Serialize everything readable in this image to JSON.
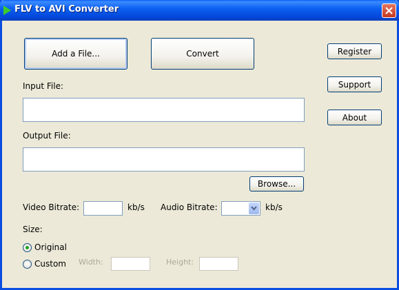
{
  "window": {
    "title": "FLV to AVI Converter"
  },
  "buttons": {
    "add_file": "Add a File...",
    "convert": "Convert",
    "register": "Register",
    "support": "Support",
    "about": "About",
    "browse": "Browse..."
  },
  "input_file": {
    "label": "Input File:",
    "value": ""
  },
  "output_file": {
    "label": "Output File:",
    "value": ""
  },
  "video_bitrate": {
    "label": "Video Bitrate:",
    "value": "",
    "unit": "kb/s"
  },
  "audio_bitrate": {
    "label": "Audio Bitrate:",
    "selected": "",
    "unit": "kb/s"
  },
  "size": {
    "label": "Size:",
    "options": [
      {
        "label": "Original",
        "selected": true
      },
      {
        "label": "Custom",
        "selected": false
      }
    ],
    "width_label": "Width:",
    "height_label": "Height:",
    "width_value": "",
    "height_value": ""
  },
  "colors": {
    "titlebar": "#0A5FF7",
    "window_bg": "#ECE9D8",
    "radio_dot": "#21A121"
  }
}
